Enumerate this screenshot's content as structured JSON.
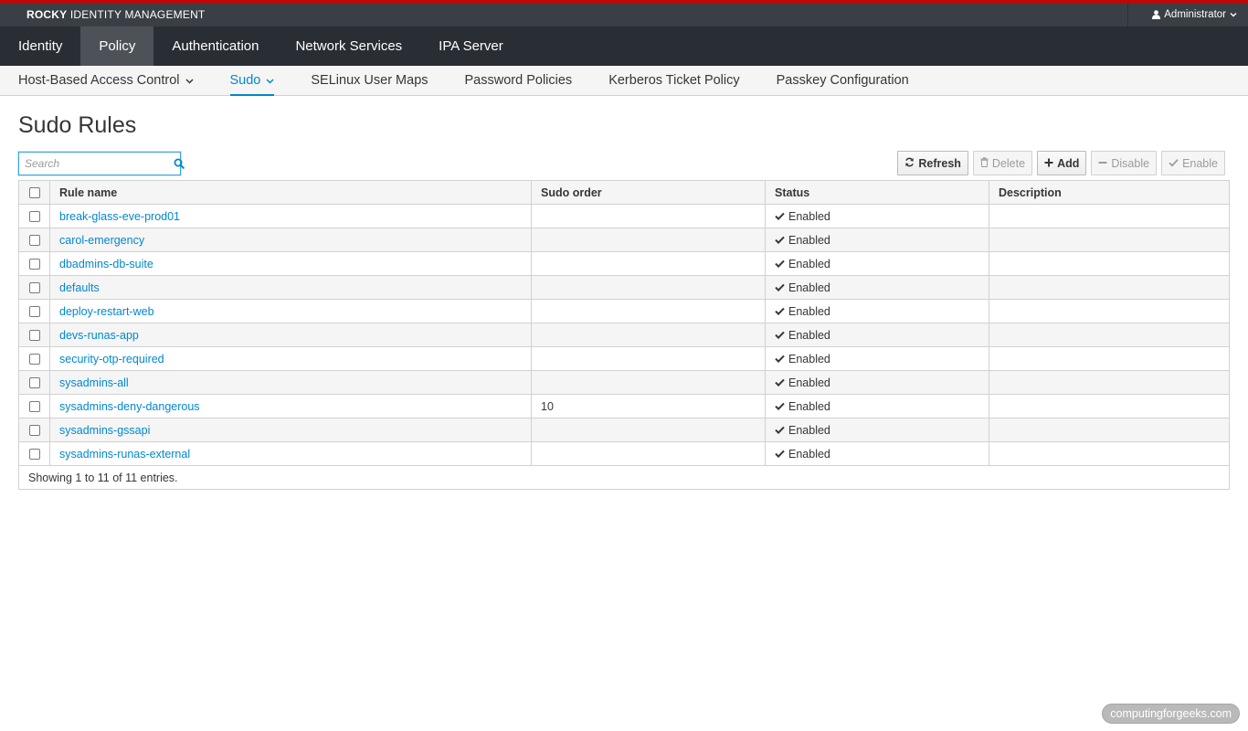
{
  "brand": {
    "bold": "ROCKY",
    "rest": " IDENTITY MANAGEMENT"
  },
  "user": {
    "label": "Administrator"
  },
  "main_nav": [
    {
      "label": "Identity",
      "active": false
    },
    {
      "label": "Policy",
      "active": true
    },
    {
      "label": "Authentication",
      "active": false
    },
    {
      "label": "Network Services",
      "active": false
    },
    {
      "label": "IPA Server",
      "active": false
    }
  ],
  "sub_nav": [
    {
      "label": "Host-Based Access Control",
      "dropdown": true,
      "active": false
    },
    {
      "label": "Sudo",
      "dropdown": true,
      "active": true
    },
    {
      "label": "SELinux User Maps",
      "dropdown": false,
      "active": false
    },
    {
      "label": "Password Policies",
      "dropdown": false,
      "active": false
    },
    {
      "label": "Kerberos Ticket Policy",
      "dropdown": false,
      "active": false
    },
    {
      "label": "Passkey Configuration",
      "dropdown": false,
      "active": false
    }
  ],
  "page": {
    "title": "Sudo Rules"
  },
  "search": {
    "placeholder": "Search",
    "value": ""
  },
  "toolbar": {
    "refresh": "Refresh",
    "delete": "Delete",
    "add": "Add",
    "disable": "Disable",
    "enable": "Enable"
  },
  "table": {
    "columns": [
      "Rule name",
      "Sudo order",
      "Status",
      "Description"
    ],
    "rows": [
      {
        "name": "break-glass-eve-prod01",
        "order": "",
        "status": "Enabled",
        "description": ""
      },
      {
        "name": "carol-emergency",
        "order": "",
        "status": "Enabled",
        "description": ""
      },
      {
        "name": "dbadmins-db-suite",
        "order": "",
        "status": "Enabled",
        "description": ""
      },
      {
        "name": "defaults",
        "order": "",
        "status": "Enabled",
        "description": ""
      },
      {
        "name": "deploy-restart-web",
        "order": "",
        "status": "Enabled",
        "description": ""
      },
      {
        "name": "devs-runas-app",
        "order": "",
        "status": "Enabled",
        "description": ""
      },
      {
        "name": "security-otp-required",
        "order": "",
        "status": "Enabled",
        "description": ""
      },
      {
        "name": "sysadmins-all",
        "order": "",
        "status": "Enabled",
        "description": ""
      },
      {
        "name": "sysadmins-deny-dangerous",
        "order": "10",
        "status": "Enabled",
        "description": ""
      },
      {
        "name": "sysadmins-gssapi",
        "order": "",
        "status": "Enabled",
        "description": ""
      },
      {
        "name": "sysadmins-runas-external",
        "order": "",
        "status": "Enabled",
        "description": ""
      }
    ],
    "footer": "Showing 1 to 11 of 11 entries."
  },
  "watermark": "computingforgeeks.com",
  "colors": {
    "accent": "#0088ce",
    "topbar": "#393f44",
    "nav": "#292e34",
    "redline": "#cc0000"
  }
}
